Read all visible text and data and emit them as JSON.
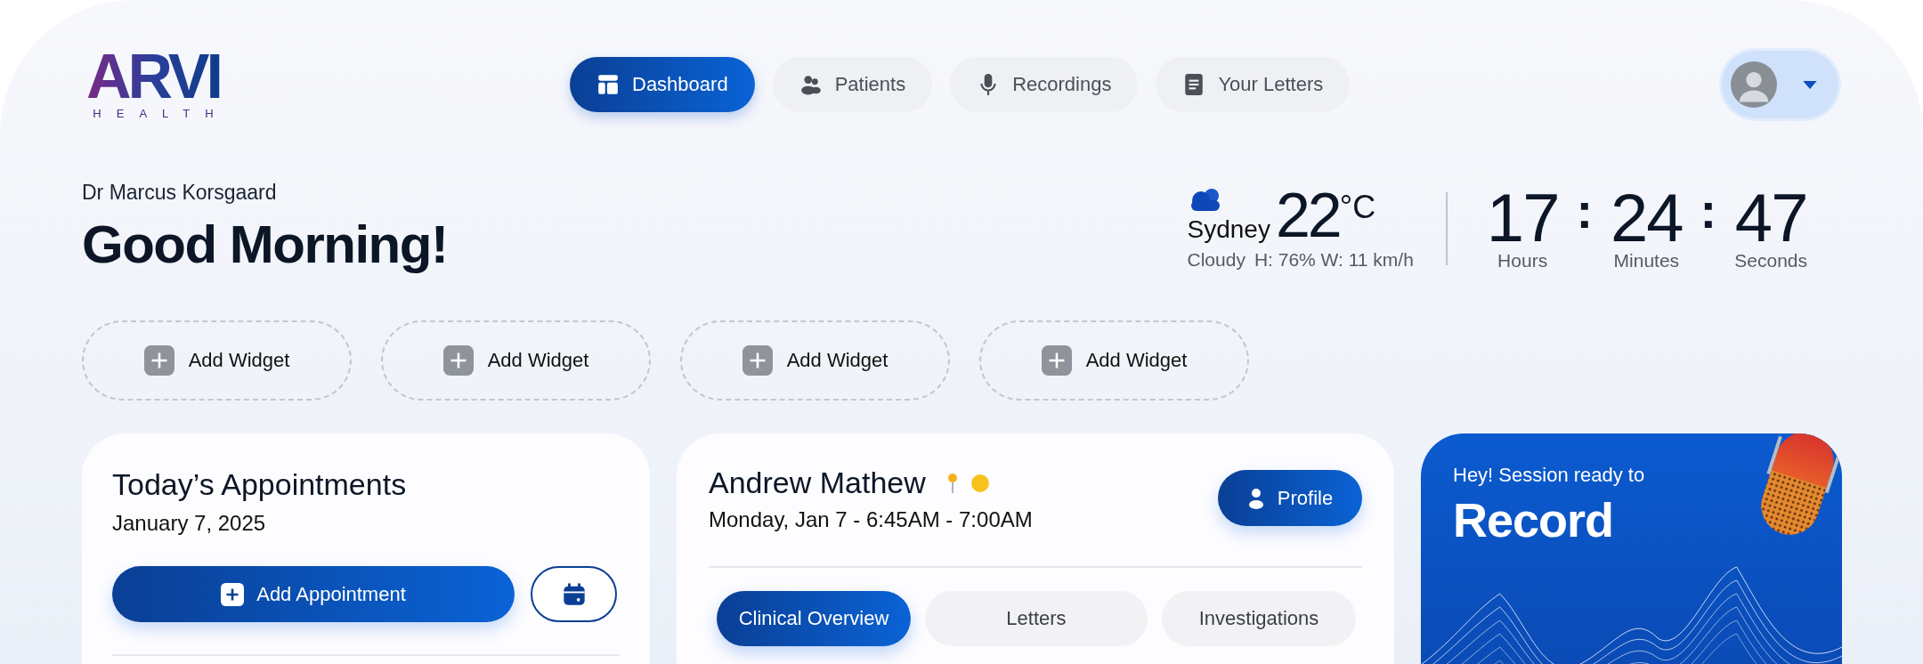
{
  "logo": {
    "mark": "ARVI",
    "subtitle": "HEALTH"
  },
  "nav": [
    {
      "label": "Dashboard",
      "kind": "dashboard",
      "selected": true
    },
    {
      "label": "Patients",
      "kind": "people",
      "selected": false
    },
    {
      "label": "Recordings",
      "kind": "mic",
      "selected": false
    },
    {
      "label": "Your Letters",
      "kind": "doc",
      "selected": false
    }
  ],
  "user_menu": {
    "expanded": false
  },
  "greeting": {
    "name": "Dr Marcus Korsgaard",
    "title": "Good Morning!"
  },
  "weather": {
    "city": "Sydney",
    "temperature": "22",
    "unit": "°C",
    "condition": "Cloudy",
    "details": "H: 76% W: 11 km/h"
  },
  "clock": {
    "separator": ":",
    "parts": [
      {
        "value": "17",
        "label": "Hours"
      },
      {
        "value": "24",
        "label": "Minutes"
      },
      {
        "value": "47",
        "label": "Seconds"
      }
    ]
  },
  "widgets": [
    "Add Widget",
    "Add Widget",
    "Add Widget",
    "Add Widget"
  ],
  "appointments": {
    "title": "Today’s Appointments",
    "date": "January 7, 2025",
    "add_button": "Add Appointment"
  },
  "patient": {
    "name": "Andrew Mathew",
    "time": "Monday, Jan 7 - 6:45AM - 7:00AM",
    "profile_button": "Profile",
    "tabs": [
      {
        "label": "Clinical Overview",
        "selected": true
      },
      {
        "label": "Letters",
        "selected": false
      },
      {
        "label": "Investigations",
        "selected": false
      }
    ]
  },
  "record": {
    "kicker": "Hey! Session ready to",
    "title": "Record"
  }
}
